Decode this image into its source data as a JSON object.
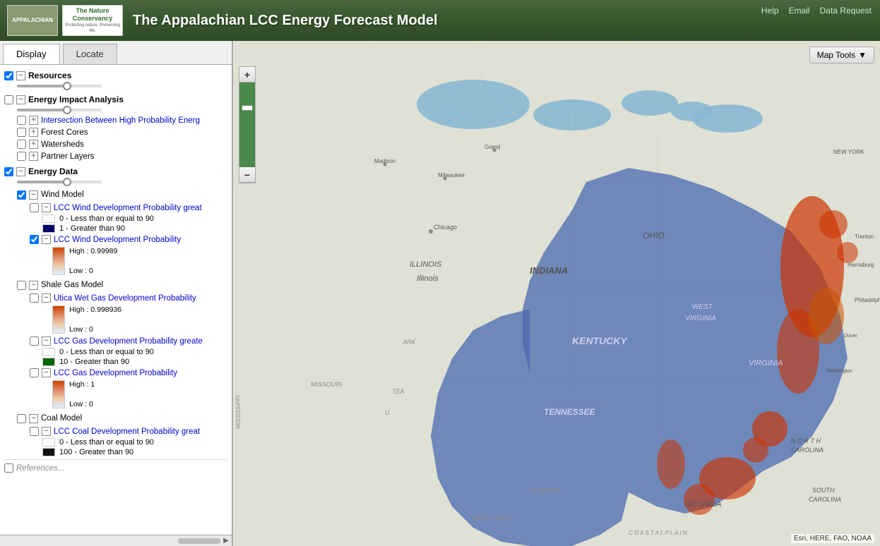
{
  "header": {
    "title": "The Appalachian LCC Energy Forecast Model",
    "logo_appalachian": "APPALACHIAN",
    "logo_tnc": "The Nature Conservancy",
    "logo_tnc_sub": "Protecting nature. Preserving life.",
    "nav_help": "Help",
    "nav_email": "Email",
    "nav_data_request": "Data Request"
  },
  "tabs": [
    {
      "label": "Display",
      "active": true
    },
    {
      "label": "Locate",
      "active": false
    }
  ],
  "layers": {
    "resources": {
      "label": "Resources",
      "checked": true,
      "expanded": true
    },
    "energy_impact": {
      "label": "Energy Impact Analysis",
      "checked": false,
      "expanded": true,
      "children": [
        {
          "label": "Intersection Between High Probability Energ",
          "checked": false,
          "link": true
        },
        {
          "label": "Forest Cores",
          "checked": false
        },
        {
          "label": "Watersheds",
          "checked": false
        },
        {
          "label": "Partner Layers",
          "checked": false
        }
      ]
    },
    "energy_data": {
      "label": "Energy Data",
      "checked": true,
      "expanded": true
    },
    "wind_model": {
      "label": "Wind Model",
      "checked": true,
      "expanded": true,
      "children": [
        {
          "label": "LCC Wind Development Probability great",
          "checked": false,
          "link": true,
          "legend": [
            {
              "color": "#ffffff",
              "label": "0 - Less than or equal to 90"
            },
            {
              "color": "#000066",
              "label": "1 - Greater than 90"
            }
          ]
        },
        {
          "label": "LCC Wind Development Probability",
          "checked": true,
          "link": true,
          "gradient_high": "#cc4400",
          "gradient_low": "#ddeeff",
          "high_label": "High : 0.99989",
          "low_label": "Low : 0"
        }
      ]
    },
    "shale_gas": {
      "label": "Shale Gas Model",
      "checked": false,
      "expanded": true,
      "children": [
        {
          "label": "Utica Wet Gas Development Probability",
          "checked": false,
          "link": true,
          "gradient_high": "#cc4400",
          "gradient_low": "#ddeeff",
          "high_label": "High : 0.998936",
          "low_label": "Low : 0"
        },
        {
          "label": "LCC Gas Development Probability greate",
          "checked": false,
          "link": true,
          "legend": [
            {
              "color": "#ffffff",
              "label": "0 - Less than or equal to 90"
            },
            {
              "color": "#006600",
              "label": "10 - Greater than 90"
            }
          ]
        },
        {
          "label": "LCC Gas Development Probability",
          "checked": false,
          "link": true,
          "gradient_high": "#cc4400",
          "gradient_low": "#ddeeff",
          "high_label": "High : 1",
          "low_label": "Low : 0"
        }
      ]
    },
    "coal_model": {
      "label": "Coal Model",
      "checked": false,
      "expanded": true,
      "children": [
        {
          "label": "LCC Coal Development Probability great",
          "checked": false,
          "link": true,
          "legend": [
            {
              "color": "#ffffff",
              "label": "0 - Less than or equal to 90"
            },
            {
              "color": "#111111",
              "label": "100 - Greater than 90"
            }
          ]
        }
      ]
    }
  },
  "map": {
    "tools_label": "Map Tools",
    "attribution": "Esri, HERE, FAO, NOAA",
    "zoom_plus": "+",
    "zoom_minus": "−"
  }
}
